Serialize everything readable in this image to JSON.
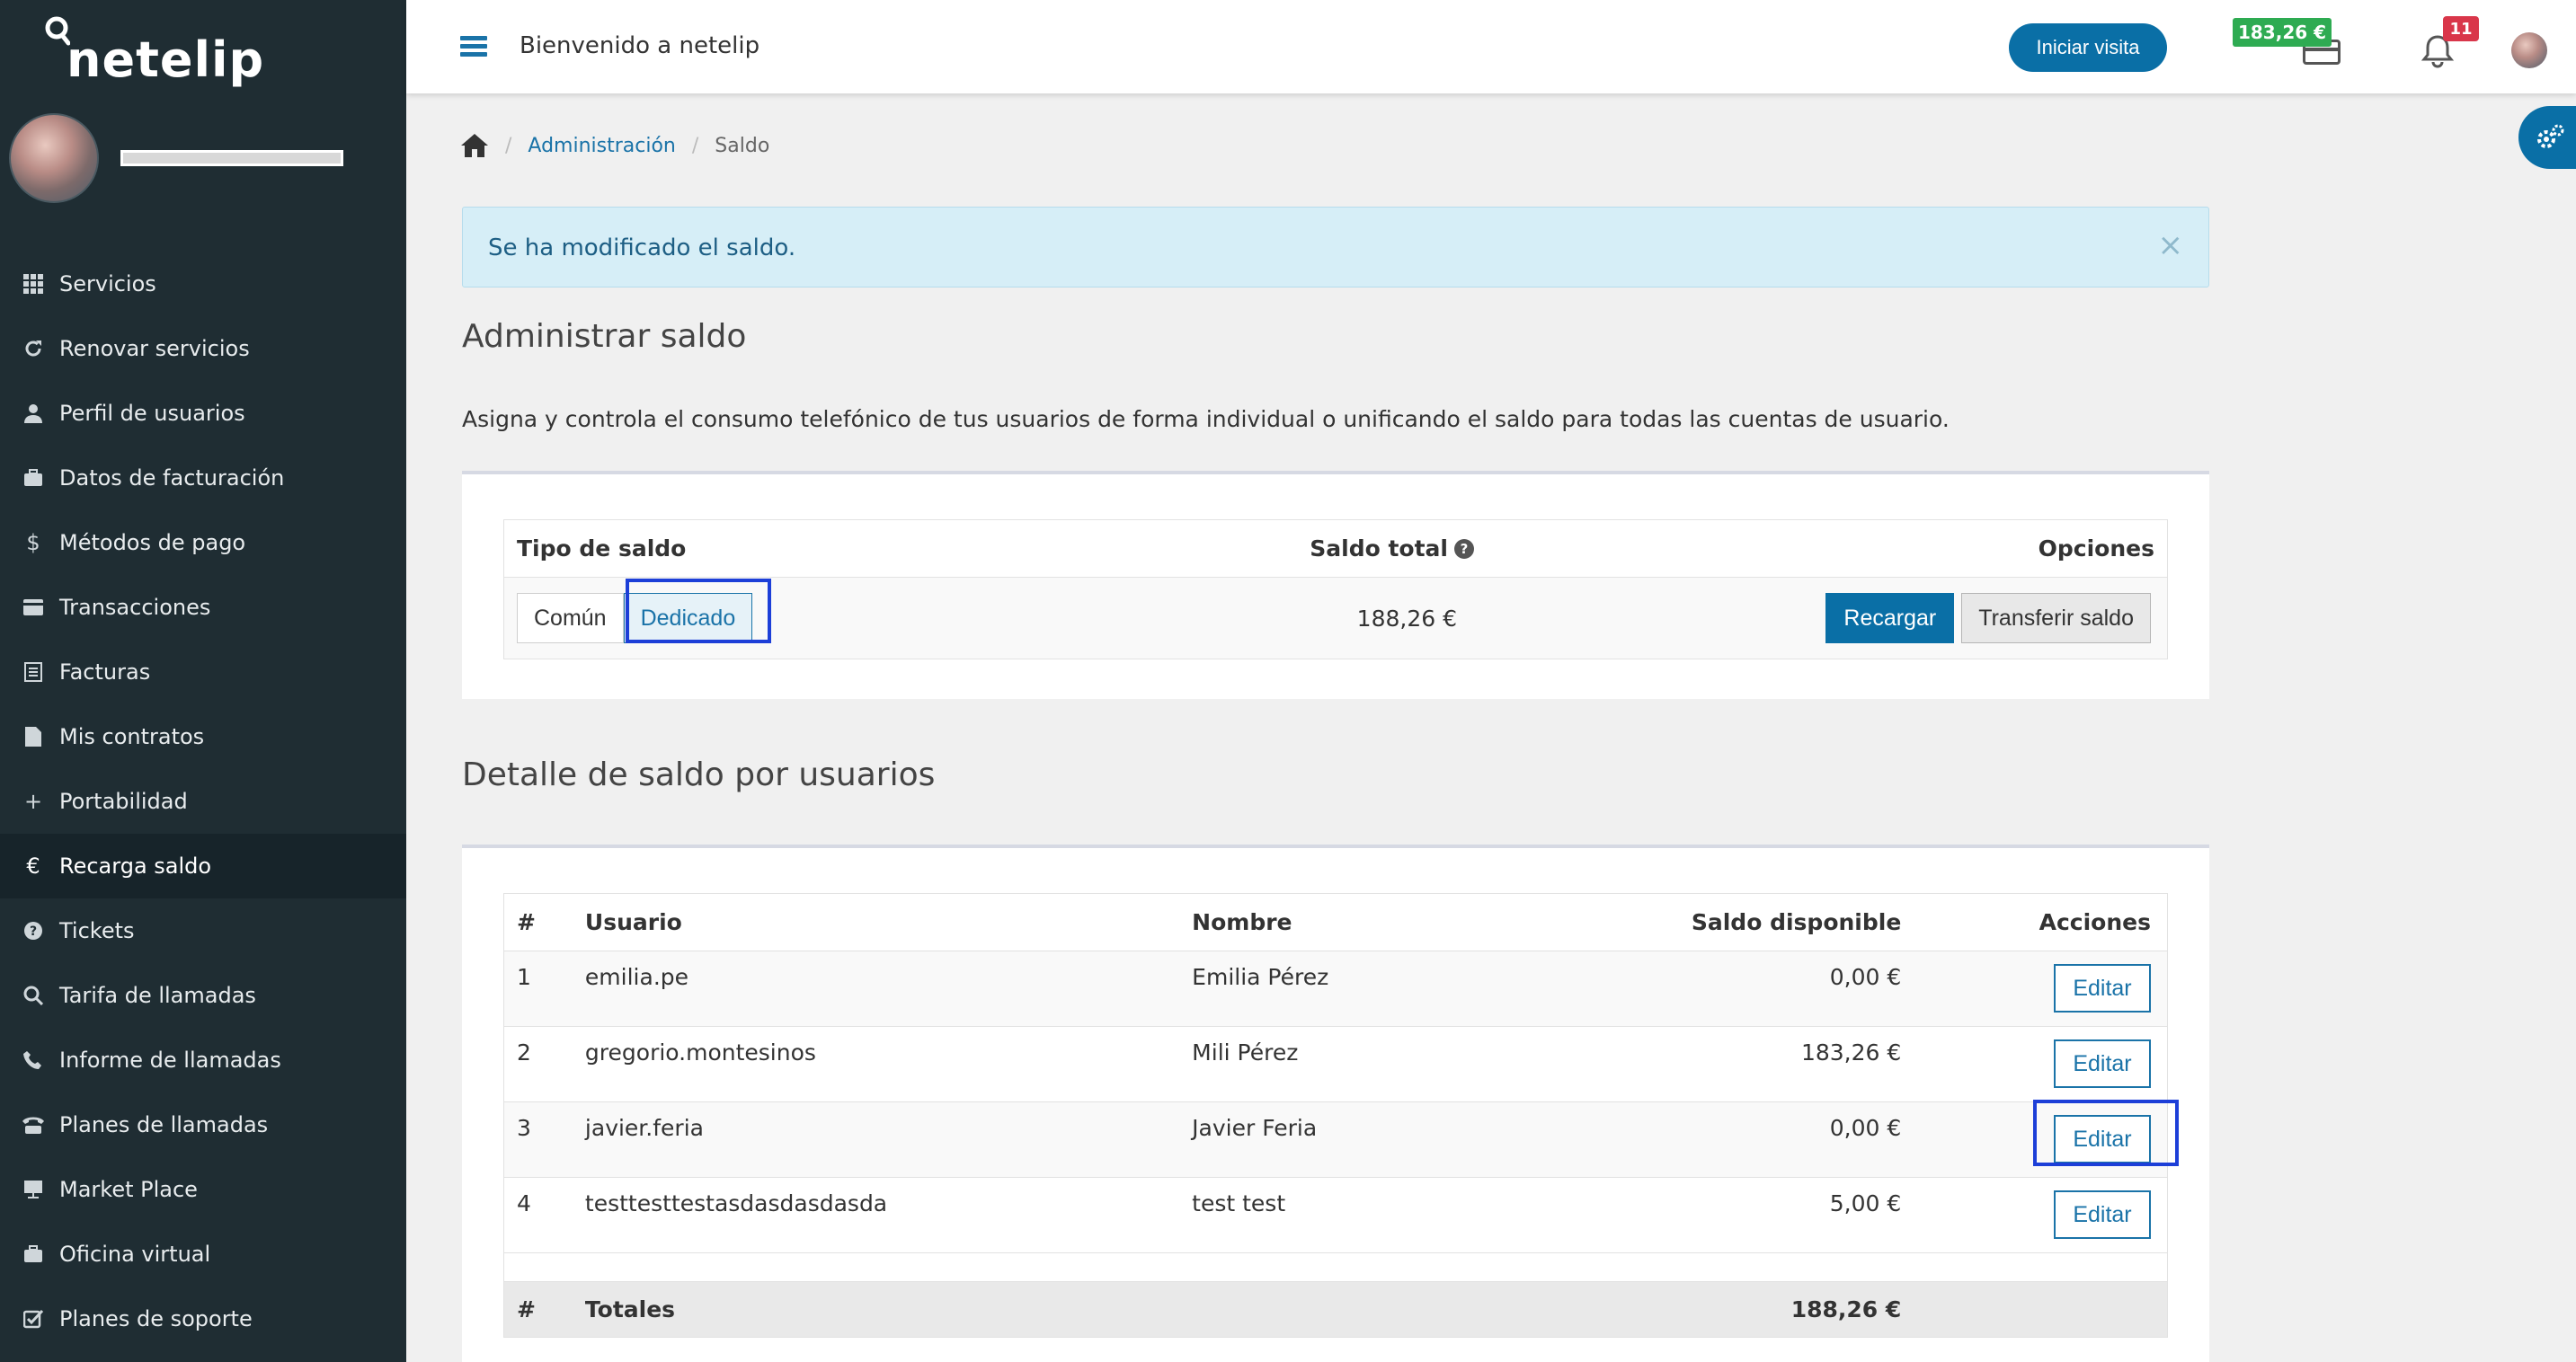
{
  "sidebar": {
    "logo_text": "netelip",
    "items": [
      {
        "label": "Servicios",
        "icon": "grid-icon"
      },
      {
        "label": "Renovar servicios",
        "icon": "refresh-icon"
      },
      {
        "label": "Perfil de usuarios",
        "icon": "user-icon"
      },
      {
        "label": "Datos de facturación",
        "icon": "briefcase-icon"
      },
      {
        "label": "Métodos de pago",
        "icon": "dollar-icon"
      },
      {
        "label": "Transacciones",
        "icon": "credit-card-icon"
      },
      {
        "label": "Facturas",
        "icon": "list-icon"
      },
      {
        "label": "Mis contratos",
        "icon": "file-icon"
      },
      {
        "label": "Portabilidad",
        "icon": "plus-icon"
      },
      {
        "label": "Recarga saldo",
        "icon": "euro-icon",
        "active": true
      },
      {
        "label": "Tickets",
        "icon": "question-icon"
      },
      {
        "label": "Tarifa de llamadas",
        "icon": "search-icon"
      },
      {
        "label": "Informe de llamadas",
        "icon": "phone-icon"
      },
      {
        "label": "Planes de llamadas",
        "icon": "desk-phone-icon"
      },
      {
        "label": "Market Place",
        "icon": "presentation-icon"
      },
      {
        "label": "Oficina virtual",
        "icon": "briefcase-icon"
      },
      {
        "label": "Planes de soporte",
        "icon": "checkbox-icon"
      }
    ]
  },
  "topbar": {
    "welcome": "Bienvenido a netelip",
    "visit_button": "Iniciar visita",
    "balance": "183,26 €",
    "notifications": "11"
  },
  "breadcrumb": {
    "home_icon": "home-icon",
    "admin": "Administración",
    "current": "Saldo"
  },
  "alert": {
    "message": "Se ha modificado el saldo.",
    "close": "×"
  },
  "admin_section": {
    "title": "Administrar saldo",
    "description": "Asigna y controla el consumo telefónico de tus usuarios de forma individual o unificando el saldo para todas las cuentas de usuario.",
    "headers": {
      "type": "Tipo de saldo",
      "total": "Saldo total",
      "options": "Opciones"
    },
    "type_options": [
      "Común",
      "Dedicado"
    ],
    "selected_type": "Dedicado",
    "total_value": "188,26 €",
    "recharge_button": "Recargar",
    "transfer_button": "Transferir saldo"
  },
  "detail_section": {
    "title": "Detalle de saldo por usuarios",
    "headers": {
      "num": "#",
      "user": "Usuario",
      "name": "Nombre",
      "balance": "Saldo disponible",
      "actions": "Acciones"
    },
    "rows": [
      {
        "num": "1",
        "user": "emilia.pe",
        "name": "Emilia Pérez",
        "balance": "0,00 €",
        "action": "Editar"
      },
      {
        "num": "2",
        "user": "gregorio.montesinos",
        "name": "Mili Pérez",
        "balance": "183,26 €",
        "action": "Editar"
      },
      {
        "num": "3",
        "user": "javier.feria",
        "name": "Javier Feria",
        "balance": "0,00 €",
        "action": "Editar"
      },
      {
        "num": "4",
        "user": "testtesttestasdasdasdasda",
        "name": "test test",
        "balance": "5,00 €",
        "action": "Editar"
      }
    ],
    "totals": {
      "num": "#",
      "label": "Totales",
      "balance": "188,26 €"
    }
  }
}
